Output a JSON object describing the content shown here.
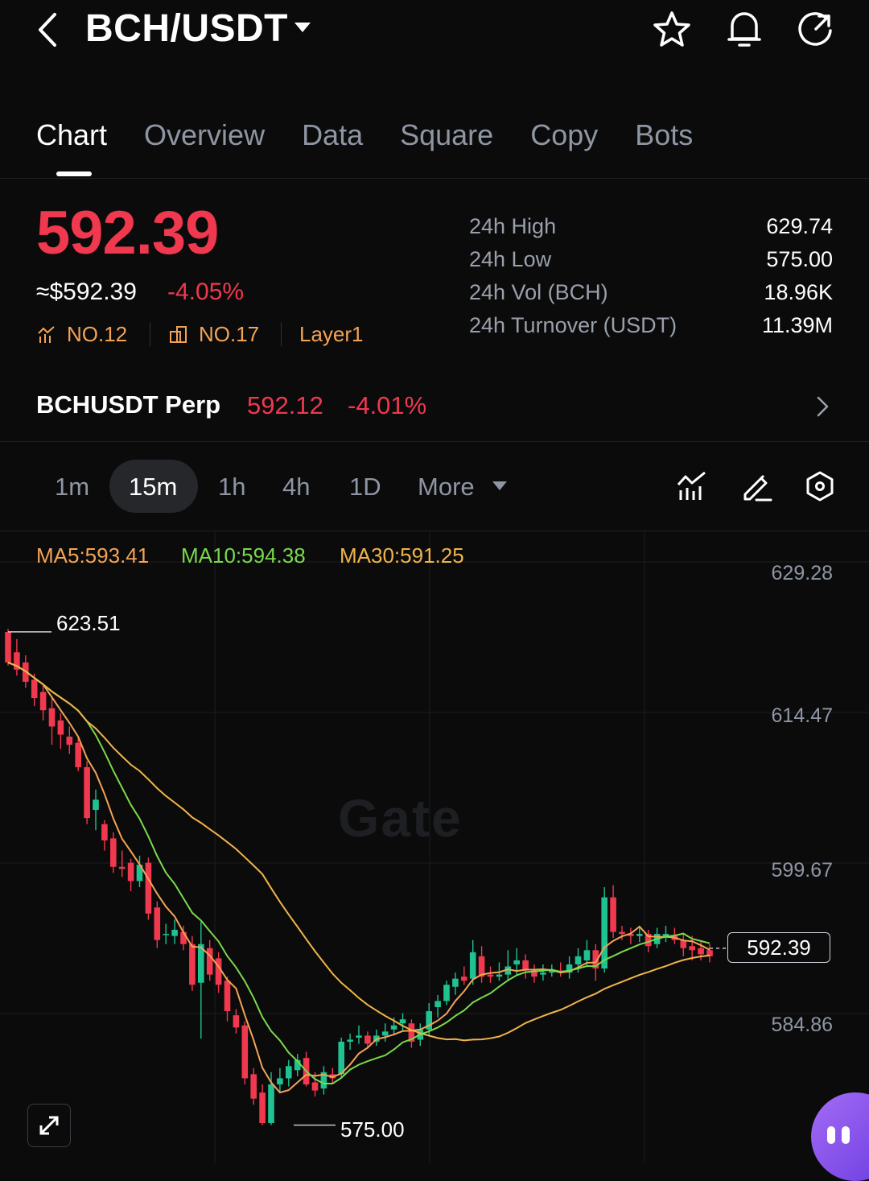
{
  "header": {
    "pair": "BCH/USDT",
    "icons": [
      "back-icon",
      "star-icon",
      "bell-icon",
      "share-icon"
    ]
  },
  "tabs": [
    {
      "label": "Chart",
      "active": true
    },
    {
      "label": "Overview"
    },
    {
      "label": "Data"
    },
    {
      "label": "Square"
    },
    {
      "label": "Copy"
    },
    {
      "label": "Bots"
    }
  ],
  "ticker": {
    "price": "592.39",
    "approx": "≈$592.39",
    "change": "-4.05%",
    "rank1": "NO.12",
    "rank2": "NO.17",
    "tag": "Layer1",
    "stats": [
      {
        "label": "24h  High",
        "value": "629.74"
      },
      {
        "label": "24h  Low",
        "value": "575.00"
      },
      {
        "label": "24h  Vol (BCH)",
        "value": "18.96K"
      },
      {
        "label": "24h  Turnover (USDT)",
        "value": "11.39M"
      }
    ]
  },
  "perp": {
    "name": "BCHUSDT Perp",
    "price": "592.12",
    "change": "-4.01%"
  },
  "intervals": {
    "items": [
      "1m",
      "15m",
      "1h",
      "4h",
      "1D"
    ],
    "selected": "15m",
    "more": "More"
  },
  "chart": {
    "ma5": "MA5:593.41",
    "ma10": "MA10:594.38",
    "ma30": "MA30:591.25",
    "axis_labels": [
      "629.28",
      "614.47",
      "599.67",
      "584.86"
    ],
    "high_marker": "623.51",
    "low_marker": "575.00",
    "last_price": "592.39",
    "watermark": "Gate"
  },
  "colors": {
    "down": "#f0384f",
    "up": "#1fc290",
    "ma5": "#f3a355",
    "ma10": "#7ad94c",
    "ma30": "#f0b44a",
    "badge": "#f3a355"
  },
  "chart_data": {
    "type": "candlestick",
    "interval": "15m",
    "y_axis_ticks": [
      629.28,
      614.47,
      599.67,
      584.86
    ],
    "high": 623.51,
    "low": 575.0,
    "last": 592.39,
    "series": [
      {
        "name": "MA5",
        "value": 593.41
      },
      {
        "name": "MA10",
        "value": 594.38
      },
      {
        "name": "MA30",
        "value": 591.25
      }
    ],
    "candles": [
      [
        623.5,
        620.5,
        623.8,
        620.2
      ],
      [
        621.5,
        619.8,
        622.8,
        619.2
      ],
      [
        620.5,
        618.6,
        621.2,
        618.0
      ],
      [
        618.8,
        617.0,
        619.4,
        616.2
      ],
      [
        617.6,
        615.8,
        618.2,
        614.8
      ],
      [
        616.0,
        614.2,
        617.2,
        612.4
      ],
      [
        614.8,
        613.4,
        615.5,
        612.0
      ],
      [
        613.2,
        612.4,
        614.2,
        611.5
      ],
      [
        612.6,
        610.2,
        613.2,
        609.8
      ],
      [
        610.2,
        605.2,
        610.8,
        604.6
      ],
      [
        606.0,
        607.0,
        608.0,
        604.0
      ],
      [
        604.6,
        603.0,
        605.0,
        602.0
      ],
      [
        603.2,
        600.4,
        603.8,
        599.8
      ],
      [
        600.4,
        600.2,
        602.0,
        599.4
      ],
      [
        600.8,
        599.0,
        601.2,
        598.0
      ],
      [
        599.0,
        600.6,
        601.5,
        598.4
      ],
      [
        600.8,
        595.8,
        601.3,
        595.2
      ],
      [
        596.4,
        593.2,
        597.0,
        592.4
      ],
      [
        593.8,
        593.8,
        594.8,
        592.8
      ],
      [
        593.6,
        594.2,
        595.2,
        592.8
      ],
      [
        594.0,
        592.8,
        594.6,
        592.2
      ],
      [
        592.8,
        588.8,
        593.6,
        588.2
      ],
      [
        589.0,
        592.8,
        595.0,
        583.5
      ],
      [
        592.4,
        589.8,
        593.2,
        589.2
      ],
      [
        591.4,
        588.8,
        592.0,
        588.0
      ],
      [
        589.2,
        586.2,
        589.6,
        585.2
      ],
      [
        585.8,
        584.6,
        586.4,
        584.0
      ],
      [
        584.8,
        579.6,
        585.2,
        579.0
      ],
      [
        580.0,
        577.6,
        580.6,
        577.0
      ],
      [
        578.2,
        575.2,
        579.0,
        575.0
      ],
      [
        575.2,
        579.0,
        580.2,
        575.0
      ],
      [
        579.0,
        579.6,
        580.6,
        578.2
      ],
      [
        579.6,
        580.8,
        581.4,
        578.8
      ],
      [
        580.4,
        581.4,
        582.0,
        579.8
      ],
      [
        581.6,
        579.0,
        582.2,
        578.8
      ],
      [
        579.2,
        578.4,
        580.2,
        577.8
      ],
      [
        578.6,
        580.2,
        580.8,
        578.0
      ],
      [
        580.0,
        579.6,
        580.6,
        579.0
      ],
      [
        580.0,
        583.2,
        583.6,
        579.6
      ],
      [
        583.2,
        583.4,
        584.0,
        582.4
      ],
      [
        583.6,
        583.8,
        584.8,
        583.0
      ],
      [
        583.8,
        583.0,
        584.2,
        582.6
      ],
      [
        583.2,
        583.8,
        584.4,
        582.8
      ],
      [
        583.8,
        584.2,
        585.0,
        583.2
      ],
      [
        584.4,
        584.8,
        585.6,
        583.8
      ],
      [
        585.0,
        585.4,
        586.0,
        584.2
      ],
      [
        585.0,
        583.2,
        585.4,
        582.6
      ],
      [
        583.4,
        584.4,
        585.0,
        582.8
      ],
      [
        584.4,
        586.2,
        587.0,
        583.8
      ],
      [
        586.6,
        587.2,
        587.8,
        585.6
      ],
      [
        587.2,
        588.8,
        589.2,
        586.8
      ],
      [
        588.6,
        589.4,
        590.0,
        587.8
      ],
      [
        589.6,
        589.2,
        590.6,
        588.8
      ],
      [
        589.4,
        592.0,
        593.2,
        588.8
      ],
      [
        591.6,
        589.6,
        592.6,
        589.0
      ],
      [
        589.8,
        589.6,
        590.6,
        589.0
      ],
      [
        589.6,
        589.8,
        591.0,
        589.2
      ],
      [
        589.8,
        590.6,
        592.2,
        589.2
      ],
      [
        590.8,
        591.2,
        592.4,
        589.8
      ],
      [
        591.2,
        590.2,
        591.8,
        589.4
      ],
      [
        590.2,
        589.6,
        590.8,
        589.0
      ],
      [
        589.8,
        590.0,
        590.8,
        589.2
      ],
      [
        590.0,
        590.2,
        590.8,
        589.6
      ],
      [
        590.2,
        590.0,
        591.0,
        589.6
      ],
      [
        590.0,
        590.8,
        591.6,
        589.4
      ],
      [
        590.8,
        591.6,
        592.4,
        590.0
      ],
      [
        591.2,
        592.2,
        593.2,
        590.6
      ],
      [
        592.2,
        590.4,
        592.8,
        589.2
      ],
      [
        590.4,
        597.4,
        598.4,
        590.0
      ],
      [
        597.4,
        594.0,
        598.6,
        593.4
      ],
      [
        594.0,
        593.8,
        594.6,
        593.2
      ],
      [
        593.8,
        593.6,
        594.4,
        592.8
      ],
      [
        593.6,
        593.8,
        594.6,
        593.0
      ],
      [
        593.8,
        592.6,
        594.2,
        592.0
      ],
      [
        592.8,
        593.8,
        594.4,
        592.4
      ],
      [
        593.6,
        593.8,
        594.6,
        593.0
      ],
      [
        593.6,
        593.2,
        594.4,
        592.8
      ],
      [
        593.2,
        592.4,
        593.8,
        591.6
      ],
      [
        592.6,
        592.2,
        593.6,
        591.2
      ],
      [
        592.4,
        591.8,
        593.0,
        591.2
      ],
      [
        592.2,
        591.6,
        592.8,
        591.0
      ]
    ]
  }
}
